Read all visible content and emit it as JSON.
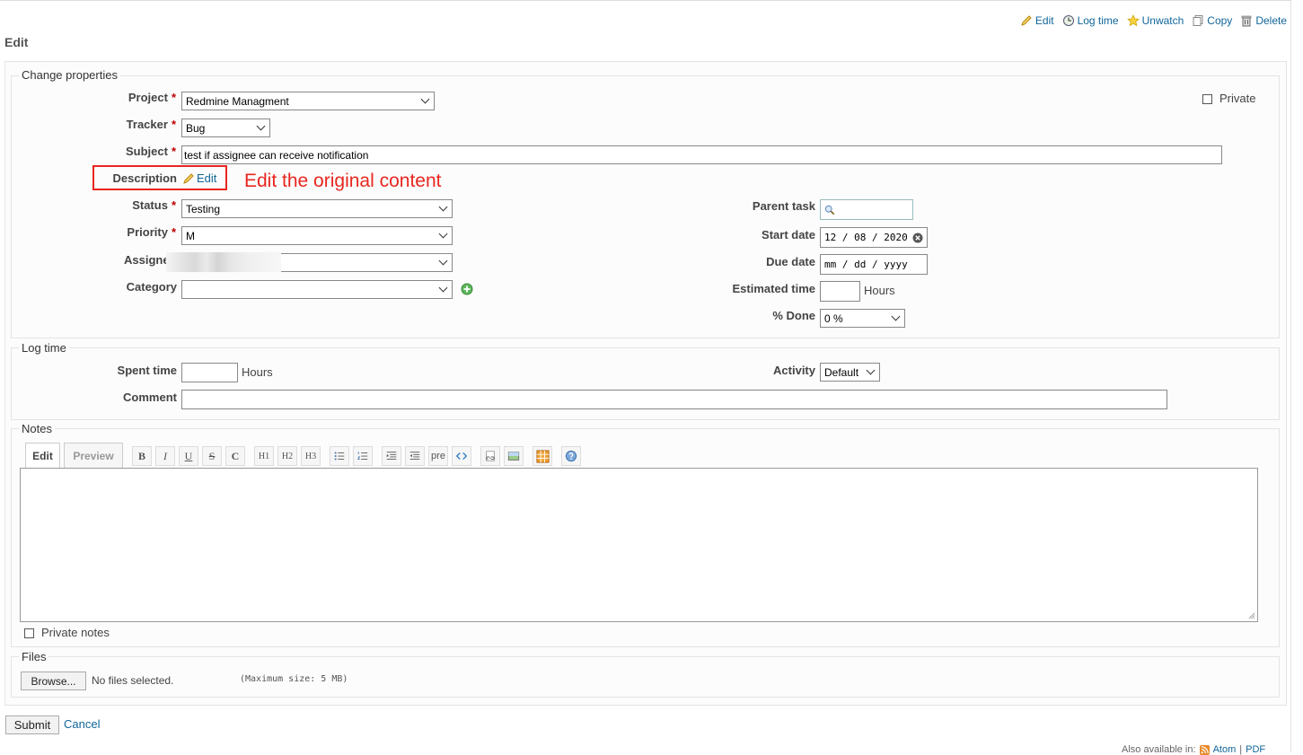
{
  "toolbar": {
    "edit": "Edit",
    "log_time": "Log time",
    "unwatch": "Unwatch",
    "copy": "Copy",
    "delete": "Delete"
  },
  "page_title": "Edit",
  "change_properties": {
    "legend": "Change properties",
    "project_label": "Project",
    "project_value": "Redmine Managment",
    "tracker_label": "Tracker",
    "tracker_value": "Bug",
    "subject_label": "Subject",
    "subject_value": "test if assignee can receive notification",
    "description_label": "Description",
    "description_edit": "Edit",
    "annotation": "Edit the original content",
    "private_label": "Private",
    "status_label": "Status",
    "status_value": "Testing",
    "priority_label": "Priority",
    "priority_value": "M",
    "assignee_label": "Assigne",
    "category_label": "Category",
    "parent_task_label": "Parent task",
    "start_date_label": "Start date",
    "start_date_value": "12 / 08 / 2020",
    "due_date_label": "Due date",
    "due_date_value": "mm / dd / yyyy",
    "estimated_time_label": "Estimated time",
    "hours": "Hours",
    "done_label": "% Done",
    "done_value": "0 %",
    "required_mark": "*"
  },
  "log_time": {
    "legend": "Log time",
    "spent_time_label": "Spent time",
    "hours": "Hours",
    "activity_label": "Activity",
    "activity_value": "Default",
    "comment_label": "Comment"
  },
  "notes": {
    "legend": "Notes",
    "tab_edit": "Edit",
    "tab_preview": "Preview",
    "toolbar": {
      "bold": "B",
      "italic": "I",
      "underline": "U",
      "strike": "S",
      "code": "C",
      "h1": "H1",
      "h2": "H2",
      "h3": "H3",
      "pre": "pre"
    },
    "private_notes": "Private notes"
  },
  "files": {
    "legend": "Files",
    "browse": "Browse...",
    "no_files": "No files selected.",
    "max_size": "(Maximum size: 5 MB)"
  },
  "actions": {
    "submit": "Submit",
    "cancel": "Cancel"
  },
  "footer": {
    "also_available": "Also available in:",
    "atom": "Atom",
    "separator": "|",
    "pdf": "PDF"
  },
  "colors": {
    "link": "#116699",
    "required": "#bb0000",
    "annotation": "#e8261f"
  }
}
